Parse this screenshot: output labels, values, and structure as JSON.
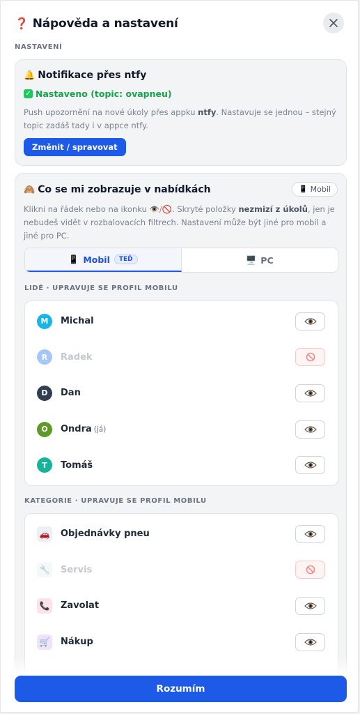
{
  "header": {
    "icon": "question-mark-icon",
    "title": "Nápověda a nastavení"
  },
  "settings_label": "NASTAVENÍ",
  "ntfy": {
    "icon": "bell-icon",
    "title": "Notifikace přes ntfy",
    "status": "Nastaveno (topic: ovapneu)",
    "desc_pre": "Push upozornění na nové úkoly přes appku ",
    "desc_bold": "ntfy",
    "desc_post": ". Nastavuje se jednou – stejný topic zadáš tady i v appce ntfy.",
    "button": "Změnit / spravovat"
  },
  "visibility": {
    "icon": "monkey-icon",
    "title": "Co se mi zobrazuje v nabídkách",
    "device_chip": "Mobil",
    "desc_pre": "Klikni na řádek nebo na ikonku 👁️/🚫. Skryté položky ",
    "desc_bold": "nezmizí z úkolů",
    "desc_post": ", jen je nebudeš vidět v rozbalovacích filtrech. Nastavení může být jiné pro mobil a jiné pro PC.",
    "tabs": [
      {
        "label": "Mobil",
        "badge": "TEĎ"
      },
      {
        "label": "PC"
      }
    ],
    "people_label": "LIDÉ · UPRAVUJE SE PROFIL MOBILU",
    "people": [
      {
        "initial": "M",
        "name": "Michal",
        "note": "",
        "color": "#17b6e6",
        "visible": true
      },
      {
        "initial": "R",
        "name": "Radek",
        "note": "",
        "color": "#3b82f6",
        "visible": false
      },
      {
        "initial": "D",
        "name": "Dan",
        "note": "",
        "color": "#2f3e52",
        "visible": true
      },
      {
        "initial": "O",
        "name": "Ondra",
        "note": "(já)",
        "color": "#5e9a2a",
        "visible": true
      },
      {
        "initial": "T",
        "name": "Tomáš",
        "note": "",
        "color": "#16b49a",
        "visible": true
      }
    ],
    "categories_label": "KATEGORIE · UPRAVUJE SE PROFIL MOBILU",
    "categories": [
      {
        "icon": "car-icon",
        "glyph": "🚗",
        "name": "Objednávky pneu",
        "bg": "#eceff3",
        "visible": true
      },
      {
        "icon": "wrench-icon",
        "glyph": "🔧",
        "name": "Servis",
        "bg": "#eceff3",
        "visible": false
      },
      {
        "icon": "phone-icon",
        "glyph": "📞",
        "name": "Zavolat",
        "bg": "#fde2ec",
        "visible": true
      },
      {
        "icon": "cart-icon",
        "glyph": "🛒",
        "name": "Nákup",
        "bg": "#efe3fb",
        "visible": true
      }
    ]
  },
  "footer_button": "Rozumím"
}
